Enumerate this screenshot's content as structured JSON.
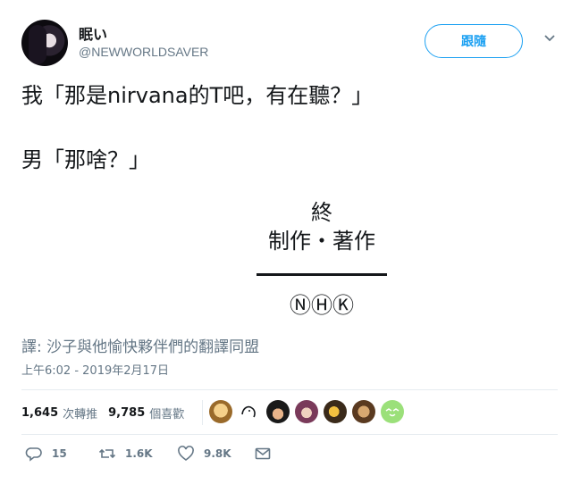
{
  "user": {
    "name": "眠い",
    "handle": "@NEWWORLDSAVER"
  },
  "follow_button": {
    "label": "跟隨"
  },
  "tweet": {
    "line1": "我「那是nirvana的T吧，有在聽？」",
    "line2": "男「那啥？」"
  },
  "end_card": {
    "title": "終",
    "credit": "制作・著作",
    "logo": "ⓃⒽⓀ"
  },
  "translation": "譯: 沙子與他愉快夥伴們的翻譯同盟",
  "timestamp": "上午6:02 - 2019年2月17日",
  "stats": {
    "retweets_count": "1,645",
    "retweets_label": "次轉推",
    "likes_count": "9,785",
    "likes_label": "個喜歡"
  },
  "actions": {
    "replies": "15",
    "retweets": "1.6K",
    "likes": "9.8K"
  },
  "colors": {
    "accent": "#1da1f2",
    "muted": "#657786",
    "divider": "#e6ecf0"
  }
}
